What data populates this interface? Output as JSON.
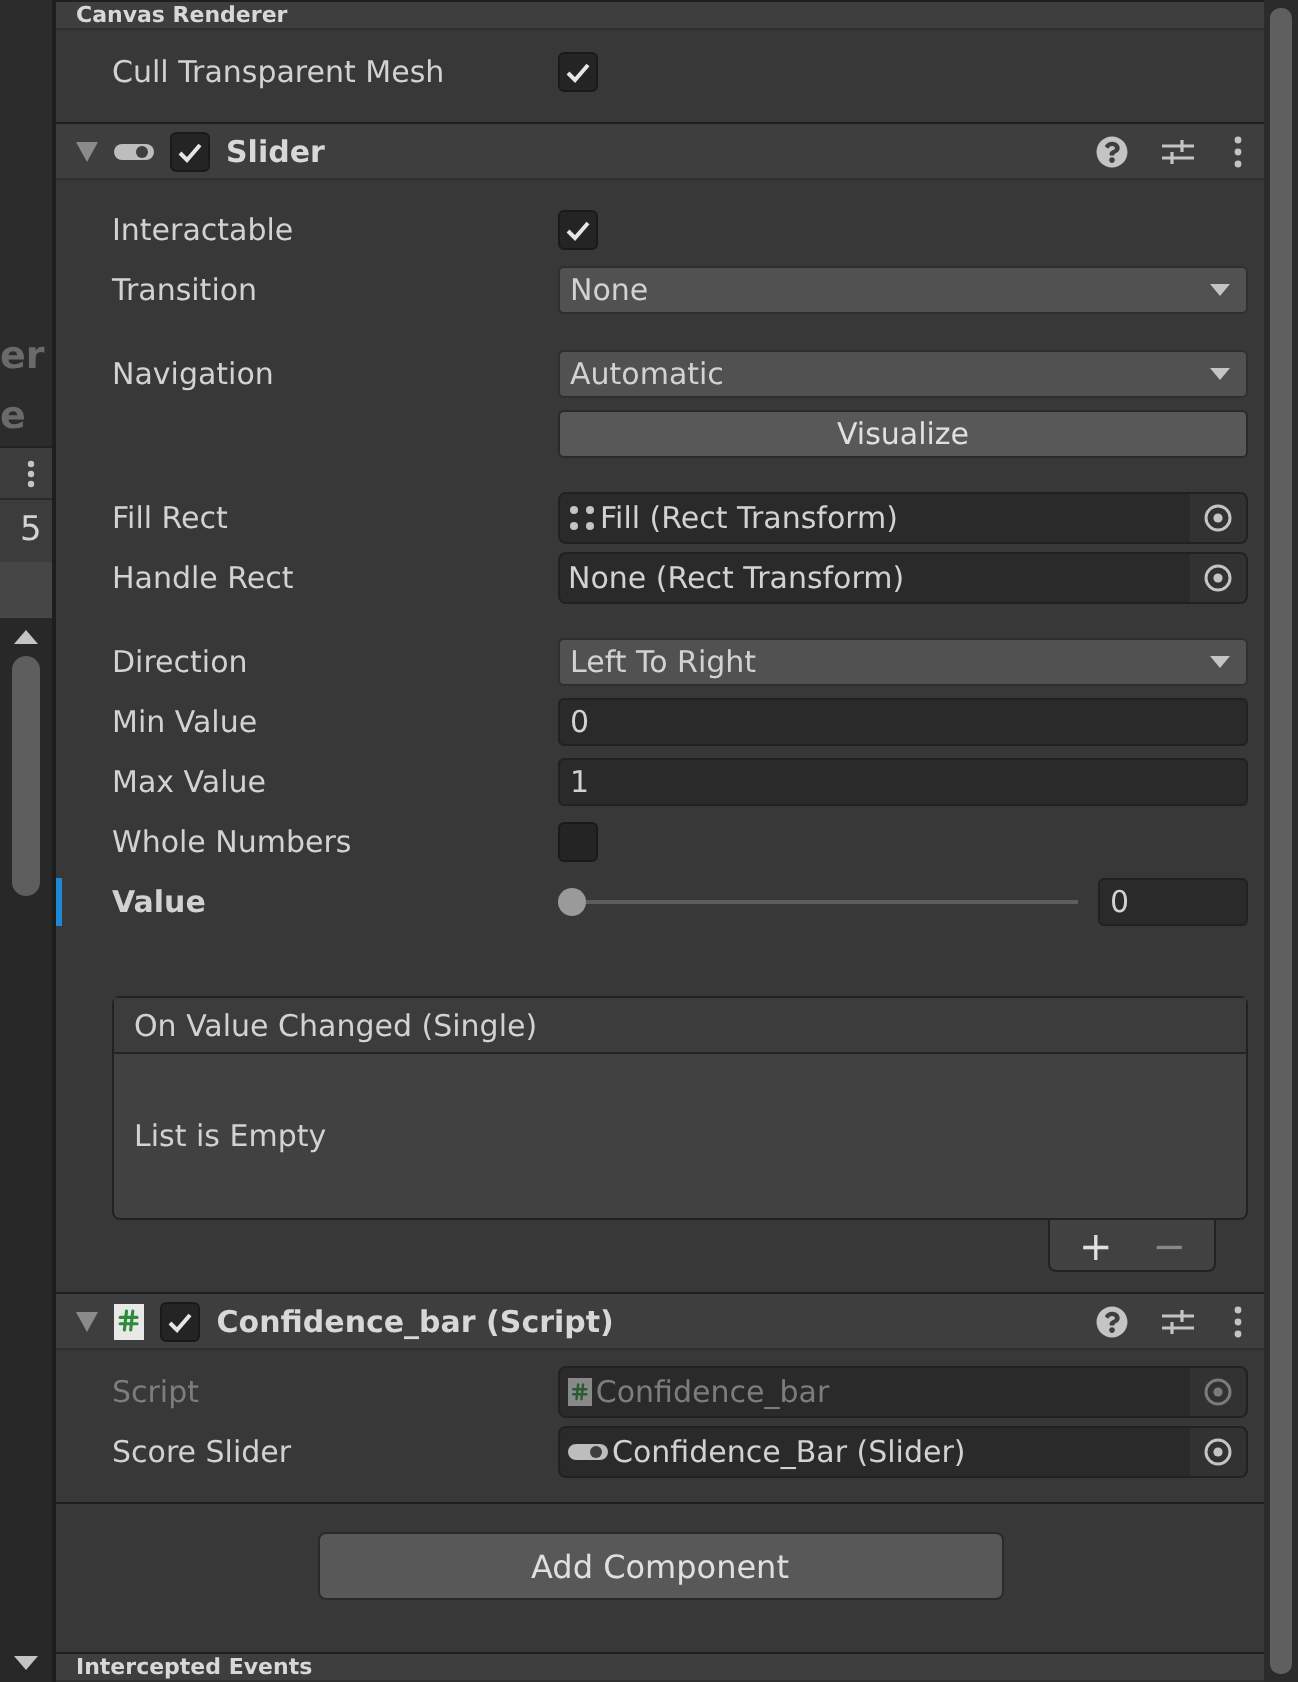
{
  "left_panel": {
    "fragments": [
      "er",
      "e"
    ],
    "value": "5"
  },
  "canvas_renderer": {
    "title": "Canvas Renderer",
    "fields": [
      {
        "kind": "checkbox",
        "label": "Cull Transparent Mesh",
        "checked": true
      }
    ]
  },
  "slider_component": {
    "title": "Slider",
    "enabled": true,
    "expanded": true,
    "groups": [
      [
        {
          "kind": "checkbox",
          "label": "Interactable",
          "checked": true
        },
        {
          "kind": "dropdown",
          "label": "Transition",
          "value": "None"
        }
      ],
      [
        {
          "kind": "dropdown",
          "label": "Navigation",
          "value": "Automatic"
        },
        {
          "kind": "button",
          "label": "Visualize"
        }
      ],
      [
        {
          "kind": "object",
          "label": "Fill Rect",
          "value": "Fill (Rect Transform)"
        },
        {
          "kind": "object",
          "label": "Handle Rect",
          "value": "None (Rect Transform)"
        }
      ],
      [
        {
          "kind": "dropdown",
          "label": "Direction",
          "value": "Left To Right"
        },
        {
          "kind": "number",
          "label": "Min Value",
          "value": "0"
        },
        {
          "kind": "number",
          "label": "Max Value",
          "value": "1"
        },
        {
          "kind": "checkbox",
          "label": "Whole Numbers",
          "checked": false
        },
        {
          "kind": "slider",
          "label": "Value",
          "value": "0",
          "level": 0,
          "modified": true
        }
      ]
    ],
    "event": {
      "title": "On Value Changed (Single)",
      "empty_text": "List is Empty",
      "add": "+",
      "remove": "−"
    }
  },
  "script_component": {
    "title": "Confidence_bar (Script)",
    "enabled": true,
    "expanded": true,
    "fields": [
      {
        "kind": "object",
        "label": "Script",
        "value": "Confidence_bar",
        "disabled": true
      },
      {
        "kind": "object",
        "label": "Score Slider",
        "value": "Confidence_Bar (Slider)",
        "disabled": false
      }
    ]
  },
  "add_component": "Add Component",
  "next_section": {
    "title": "Intercepted Events"
  }
}
